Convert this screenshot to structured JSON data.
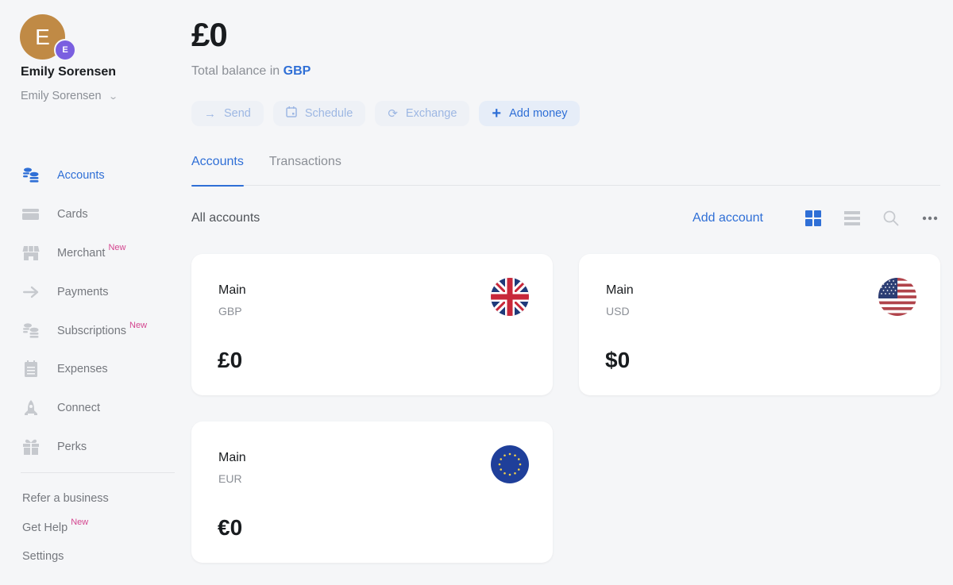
{
  "user": {
    "initial": "E",
    "badge_initial": "E",
    "name": "Emily Sorensen",
    "account_name": "Emily Sorensen"
  },
  "sidebar": {
    "items": [
      {
        "label": "Accounts",
        "icon": "coins-icon",
        "active": true,
        "badge": ""
      },
      {
        "label": "Cards",
        "icon": "card-icon",
        "active": false,
        "badge": ""
      },
      {
        "label": "Merchant",
        "icon": "store-icon",
        "active": false,
        "badge": "New"
      },
      {
        "label": "Payments",
        "icon": "arrow-right-icon",
        "active": false,
        "badge": ""
      },
      {
        "label": "Subscriptions",
        "icon": "coins-icon",
        "active": false,
        "badge": "New"
      },
      {
        "label": "Expenses",
        "icon": "clipboard-icon",
        "active": false,
        "badge": ""
      },
      {
        "label": "Connect",
        "icon": "rocket-icon",
        "active": false,
        "badge": ""
      },
      {
        "label": "Perks",
        "icon": "gift-icon",
        "active": false,
        "badge": ""
      }
    ],
    "footer": [
      {
        "label": "Refer a business",
        "badge": ""
      },
      {
        "label": "Get Help",
        "badge": "New"
      },
      {
        "label": "Settings",
        "badge": ""
      }
    ]
  },
  "header": {
    "balance": "£0",
    "balance_prefix": "Total balance in",
    "balance_currency": "GBP"
  },
  "actions": [
    {
      "label": "Send",
      "icon": "arrow-right-icon"
    },
    {
      "label": "Schedule",
      "icon": "calendar-icon"
    },
    {
      "label": "Exchange",
      "icon": "exchange-icon"
    },
    {
      "label": "Add money",
      "icon": "plus-icon"
    }
  ],
  "tabs": [
    {
      "label": "Accounts",
      "active": true
    },
    {
      "label": "Transactions",
      "active": false
    }
  ],
  "accounts_section": {
    "title": "All accounts",
    "add_account_label": "Add account",
    "tools": [
      "grid-view-icon",
      "list-view-icon",
      "search-icon",
      "more-icon"
    ]
  },
  "accounts": [
    {
      "name": "Main",
      "currency": "GBP",
      "balance": "£0",
      "flag": "uk-flag-icon"
    },
    {
      "name": "Main",
      "currency": "USD",
      "balance": "$0",
      "flag": "us-flag-icon"
    },
    {
      "name": "Main",
      "currency": "EUR",
      "balance": "€0",
      "flag": "eu-flag-icon"
    }
  ],
  "colors": {
    "accent": "#2f6fd6",
    "new_badge": "#d4458f",
    "avatar": "#c08a45",
    "avatar_badge": "#7a5fe0"
  }
}
